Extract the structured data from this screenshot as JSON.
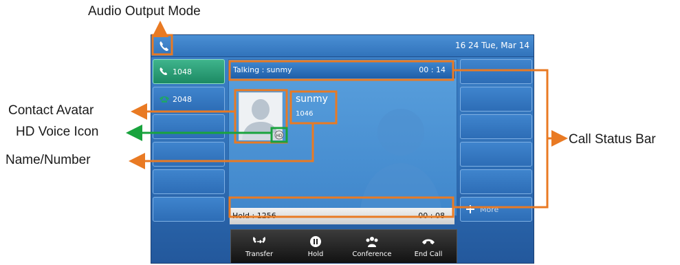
{
  "callouts": {
    "audio_output_mode": "Audio Output Mode",
    "contact_avatar": "Contact Avatar",
    "hd_voice_icon": "HD Voice Icon",
    "name_number": "Name/Number",
    "call_status_bar": "Call Status Bar"
  },
  "phone": {
    "datetime": "16 24 Tue, Mar 14",
    "lines": [
      {
        "label": "1048",
        "icon": "handset-icon",
        "active": true
      },
      {
        "label": "2048",
        "icon": "ring-handset-icon",
        "active": false
      }
    ],
    "talk_bar": {
      "status": "Talking : sunmy",
      "timer": "00 : 14"
    },
    "hold_bar": {
      "status": "Hold : 1256",
      "timer": "00 : 08"
    },
    "contact": {
      "name": "sunmy",
      "number": "1046"
    },
    "more_label": "More",
    "softkeys": [
      {
        "label": "Transfer",
        "icon": "transfer-icon"
      },
      {
        "label": "Hold",
        "icon": "pause-icon"
      },
      {
        "label": "Conference",
        "icon": "conference-icon"
      },
      {
        "label": "End Call",
        "icon": "hangup-icon"
      }
    ]
  },
  "colors": {
    "callout_orange": "#e97a23",
    "hd_green": "#19a33d"
  }
}
